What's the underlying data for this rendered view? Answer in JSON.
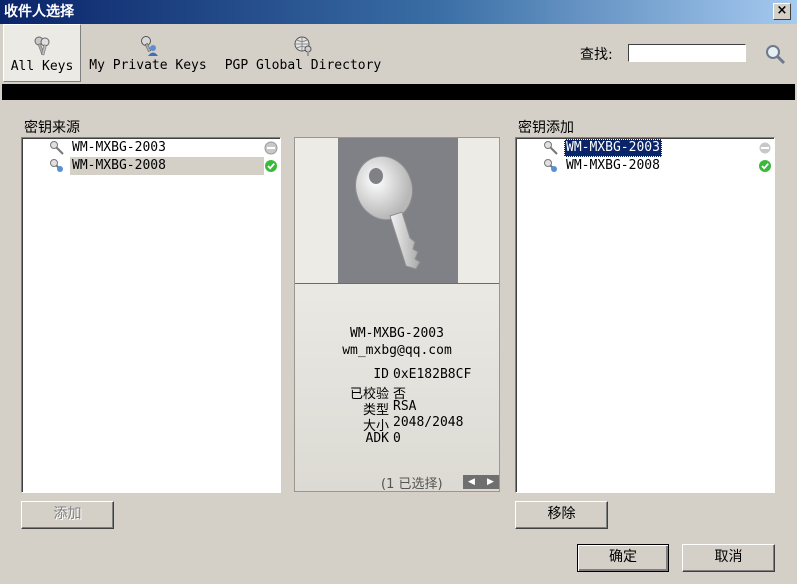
{
  "window": {
    "title": "收件人选择",
    "close_label": "×"
  },
  "toolbar": {
    "tabs": [
      {
        "label": "All Keys",
        "icon": "keys-icon",
        "selected": true
      },
      {
        "label": "My Private Keys",
        "icon": "private-key-user-icon",
        "selected": false
      },
      {
        "label": "PGP Global Directory",
        "icon": "globe-key-icon",
        "selected": false
      }
    ],
    "search_label": "查找:",
    "search_value": "",
    "search_icon": "magnifier-icon"
  },
  "source": {
    "label": "密钥来源",
    "items": [
      {
        "name": "WM-MXBG-2003",
        "status": "none"
      },
      {
        "name": "WM-MXBG-2008",
        "status": "valid"
      }
    ]
  },
  "preview": {
    "name": "WM-MXBG-2003",
    "email": "wm_mxbg@qq.com",
    "fields": [
      {
        "key": "ID",
        "value": "0xE182B8CF"
      },
      {
        "key": "已校验",
        "value": "否"
      },
      {
        "key": "类型",
        "value": "RSA"
      },
      {
        "key": "大小",
        "value": "2048/2048"
      },
      {
        "key": "ADK",
        "value": "0"
      }
    ],
    "selection_text": "(1 已选择)",
    "prev_label": "◀",
    "next_label": "▶"
  },
  "added": {
    "label": "密钥添加",
    "items": [
      {
        "name": "WM-MXBG-2003",
        "status": "none"
      },
      {
        "name": "WM-MXBG-2008",
        "status": "valid"
      }
    ]
  },
  "buttons": {
    "add": "添加",
    "remove": "移除",
    "ok": "确定",
    "cancel": "取消"
  },
  "colors": {
    "title_bar_start": "#0a246a",
    "selection_blue": "#0a246a",
    "valid_green": "#3cb93c",
    "dialog_bg": "#d4d0c8"
  }
}
